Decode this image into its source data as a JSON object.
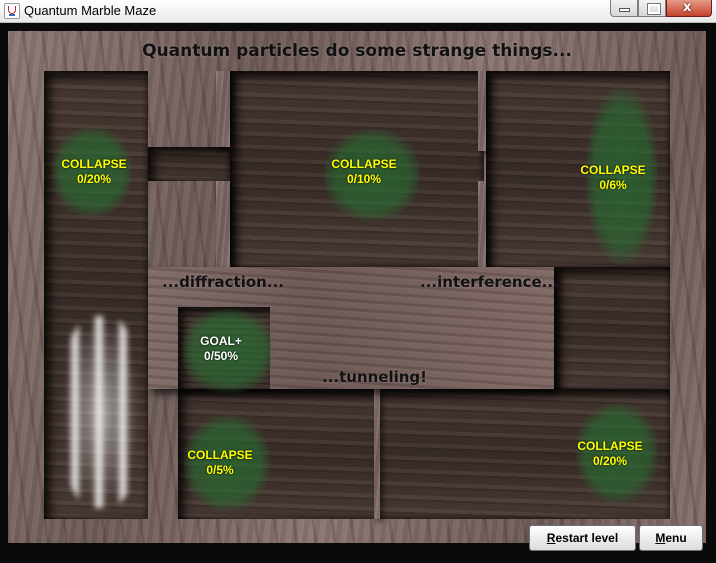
{
  "window": {
    "title": "Quantum Marble Maze",
    "buttons": {
      "minimize": "minimize",
      "maximize": "maximize",
      "close": "x"
    }
  },
  "game": {
    "headline": "Quantum particles do some strange things...",
    "captions": {
      "diffraction": "...diffraction...",
      "interference": "...interference...",
      "tunneling": "...tunneling!"
    },
    "zones": [
      {
        "type": "COLLAPSE",
        "value": "0/20%"
      },
      {
        "type": "COLLAPSE",
        "value": "0/10%"
      },
      {
        "type": "COLLAPSE",
        "value": "0/6%"
      },
      {
        "type": "GOAL+",
        "value": "0/50%"
      },
      {
        "type": "COLLAPSE",
        "value": "0/5%"
      },
      {
        "type": "COLLAPSE",
        "value": "0/20%"
      }
    ]
  },
  "controls": {
    "restart": {
      "first": "R",
      "rest": "estart level"
    },
    "menu": {
      "first": "M",
      "rest": "enu"
    }
  },
  "colors": {
    "collapse_label": "#ffff00",
    "goal_label": "#ffffff",
    "zone_fill": "#2a6e32",
    "frame": "#0a0a0a"
  }
}
